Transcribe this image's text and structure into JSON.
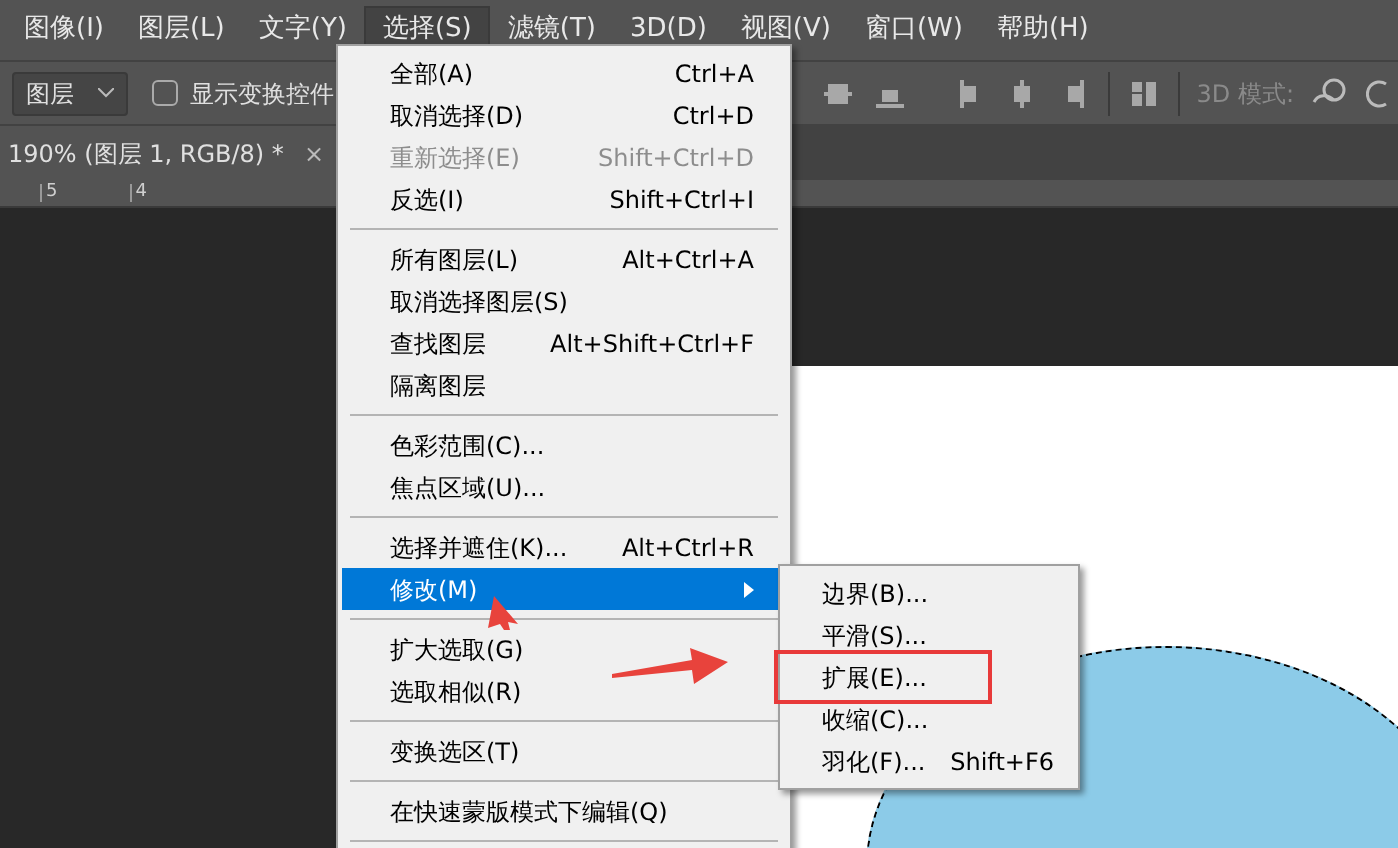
{
  "menubar": [
    {
      "label": "图像(I)",
      "selected": false
    },
    {
      "label": "图层(L)",
      "selected": false
    },
    {
      "label": "文字(Y)",
      "selected": false
    },
    {
      "label": "选择(S)",
      "selected": true
    },
    {
      "label": "滤镜(T)",
      "selected": false
    },
    {
      "label": "3D(D)",
      "selected": false
    },
    {
      "label": "视图(V)",
      "selected": false
    },
    {
      "label": "窗口(W)",
      "selected": false
    },
    {
      "label": "帮助(H)",
      "selected": false
    }
  ],
  "toolbar": {
    "target_dropdown": "图层",
    "show_transform_controls": {
      "label": "显示变换控件",
      "checked": false
    },
    "mode_label": "3D 模式:"
  },
  "document_tab": {
    "title": "190% (图层 1, RGB/8) *",
    "close": "×"
  },
  "ruler": [
    "5",
    "4"
  ],
  "select_menu": [
    {
      "kind": "item",
      "label": "全部(A)",
      "shortcut": "Ctrl+A",
      "disabled": false,
      "selected": false
    },
    {
      "kind": "item",
      "label": "取消选择(D)",
      "shortcut": "Ctrl+D",
      "disabled": false,
      "selected": false
    },
    {
      "kind": "item",
      "label": "重新选择(E)",
      "shortcut": "Shift+Ctrl+D",
      "disabled": true,
      "selected": false
    },
    {
      "kind": "item",
      "label": "反选(I)",
      "shortcut": "Shift+Ctrl+I",
      "disabled": false,
      "selected": false
    },
    {
      "kind": "separator"
    },
    {
      "kind": "item",
      "label": "所有图层(L)",
      "shortcut": "Alt+Ctrl+A",
      "disabled": false,
      "selected": false
    },
    {
      "kind": "item",
      "label": "取消选择图层(S)",
      "disabled": false,
      "selected": false
    },
    {
      "kind": "item",
      "label": "查找图层",
      "shortcut": "Alt+Shift+Ctrl+F",
      "disabled": false,
      "selected": false
    },
    {
      "kind": "item",
      "label": "隔离图层",
      "disabled": false,
      "selected": false
    },
    {
      "kind": "separator"
    },
    {
      "kind": "item",
      "label": "色彩范围(C)...",
      "disabled": false,
      "selected": false
    },
    {
      "kind": "item",
      "label": "焦点区域(U)...",
      "disabled": false,
      "selected": false
    },
    {
      "kind": "separator"
    },
    {
      "kind": "item",
      "label": "选择并遮住(K)...",
      "shortcut": "Alt+Ctrl+R",
      "disabled": false,
      "selected": false
    },
    {
      "kind": "submenu",
      "label": "修改(M)",
      "disabled": false,
      "selected": true
    },
    {
      "kind": "separator"
    },
    {
      "kind": "item",
      "label": "扩大选取(G)",
      "disabled": false,
      "selected": false
    },
    {
      "kind": "item",
      "label": "选取相似(R)",
      "disabled": false,
      "selected": false
    },
    {
      "kind": "separator"
    },
    {
      "kind": "item",
      "label": "变换选区(T)",
      "disabled": false,
      "selected": false
    },
    {
      "kind": "separator"
    },
    {
      "kind": "item",
      "label": "在快速蒙版模式下编辑(Q)",
      "disabled": false,
      "selected": false
    },
    {
      "kind": "separator"
    }
  ],
  "modify_submenu": [
    {
      "label": "边界(B)...",
      "highlighted": false
    },
    {
      "label": "平滑(S)...",
      "highlighted": false
    },
    {
      "label": "扩展(E)...",
      "highlighted": true
    },
    {
      "label": "收缩(C)...",
      "highlighted": false
    },
    {
      "label": "羽化(F)...",
      "shortcut": "Shift+F6",
      "highlighted": false
    }
  ]
}
